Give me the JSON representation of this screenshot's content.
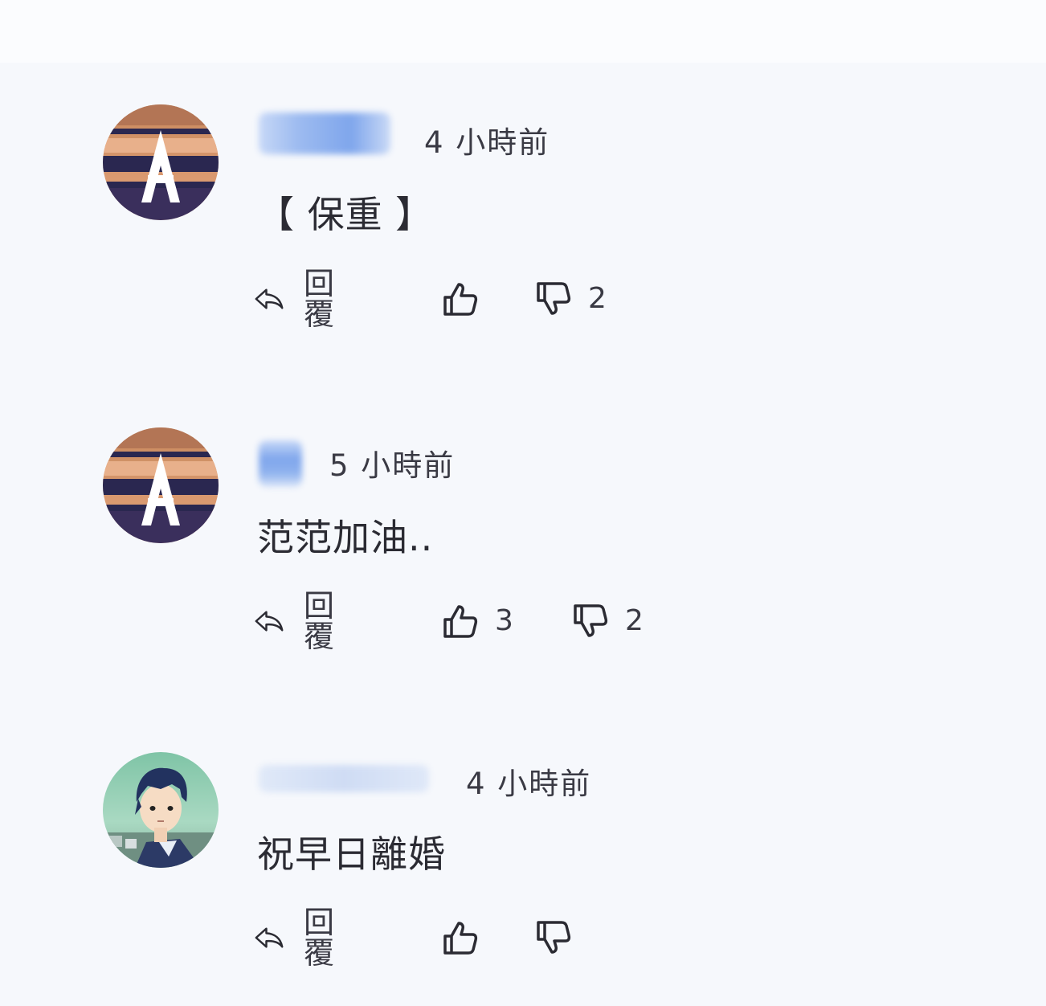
{
  "colors": {
    "background": "#f6f8fc",
    "text": "#2b2b33",
    "name_placeholder": "#8fb2ee"
  },
  "comments": [
    {
      "avatar_icon": "letter-a-logo-avatar",
      "time": "4 小時前",
      "text": "【 保重 】",
      "actions": {
        "reply_label": "回覆",
        "reply_icon": "reply-arrow-icon",
        "like_icon": "thumbs-up-icon",
        "like_count": "",
        "dislike_icon": "thumbs-down-icon",
        "dislike_count": "2"
      }
    },
    {
      "avatar_icon": "letter-a-logo-avatar",
      "time": "5 小時前",
      "text": "范范加油..",
      "actions": {
        "reply_label": "回覆",
        "reply_icon": "reply-arrow-icon",
        "like_icon": "thumbs-up-icon",
        "like_count": "3",
        "dislike_icon": "thumbs-down-icon",
        "dislike_count": "2"
      }
    },
    {
      "avatar_icon": "anime-boy-avatar",
      "time": "4 小時前",
      "text": "祝早日離婚",
      "actions": {
        "reply_label": "回覆",
        "reply_icon": "reply-arrow-icon",
        "like_icon": "thumbs-up-icon",
        "like_count": "",
        "dislike_icon": "thumbs-down-icon",
        "dislike_count": ""
      }
    }
  ]
}
